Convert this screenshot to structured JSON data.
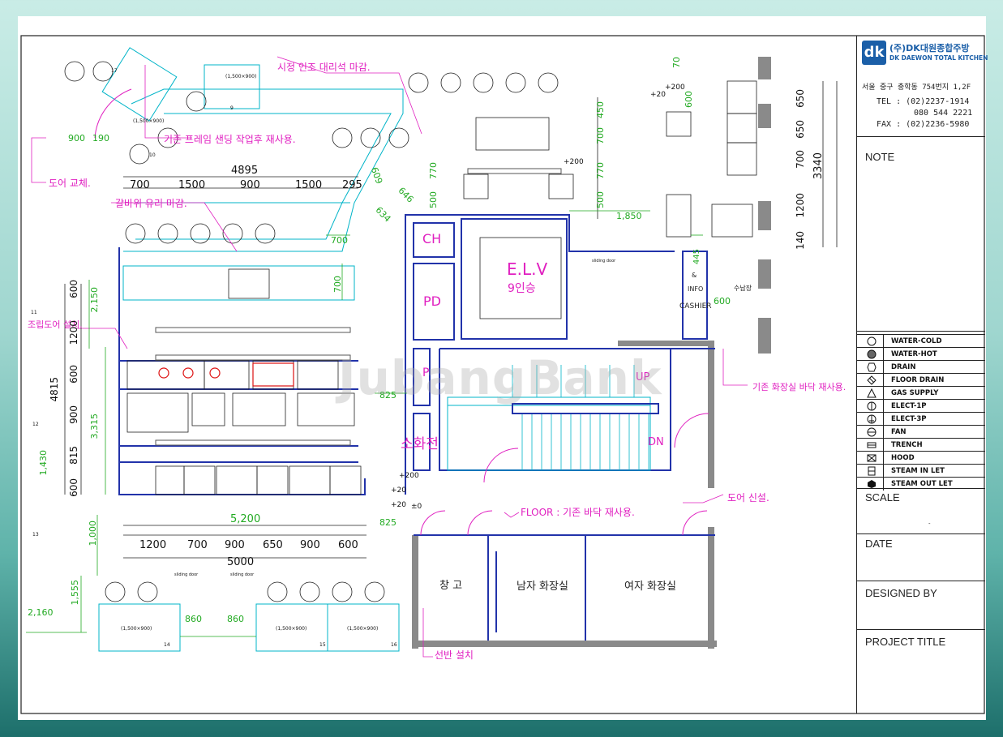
{
  "title_block": {
    "company_ko": "(주)DK대원종합주방",
    "company_en": "DK DAEWON TOTAL KITCHEN",
    "logo_text": "dk",
    "address": "서울 중구 충학동 754번지 1,2F",
    "tel": "TEL : (02)2237-1914",
    "tel2": "080 544 2221",
    "fax": "FAX : (02)2236-5980",
    "note_label": "NOTE",
    "scale_label": "SCALE",
    "scale_value": "-",
    "date_label": "DATE",
    "designed_label": "DESIGNED BY",
    "project_label": "PROJECT TITLE"
  },
  "legend": [
    {
      "icon": "circle-icon",
      "label": "WATER-COLD"
    },
    {
      "icon": "hatched-circle-icon",
      "label": "WATER-HOT"
    },
    {
      "icon": "drain-icon",
      "label": "DRAIN"
    },
    {
      "icon": "floor-drain-icon",
      "label": "FLOOR DRAIN"
    },
    {
      "icon": "triangle-icon",
      "label": "GAS SUPPLY"
    },
    {
      "icon": "elect-1p-icon",
      "label": "ELECT-1P"
    },
    {
      "icon": "elect-3p-icon",
      "label": "ELECT-3P"
    },
    {
      "icon": "fan-icon",
      "label": "FAN"
    },
    {
      "icon": "trench-icon",
      "label": "TRENCH"
    },
    {
      "icon": "hood-icon",
      "label": "HOOD"
    },
    {
      "icon": "steam-in-icon",
      "label": "STEAM IN LET"
    },
    {
      "icon": "steam-out-icon",
      "label": "STEAM OUT LET"
    }
  ],
  "annotations": {
    "marble": "시정 인조 대리석 마감.",
    "frame": "기존 프레임 샌딩 작업후 재사용.",
    "door_replace": "도어 교체.",
    "glass": "갈바위 유리 마감.",
    "storage_door": "조립도어 설치.",
    "floor": "FLOOR : 기존 바닥 재사용.",
    "new_door": "도어 신설.",
    "existing_floor": "기존 화장실 바닥 재사용.",
    "shelf": "선반 설치",
    "watermark": "JubangBank"
  },
  "rooms": {
    "ch": "CH",
    "pd": "PD",
    "p": "P",
    "hydrant": "소화전",
    "elevator": "E.L.V",
    "elevator_cap": "9인승",
    "info": "&",
    "info2": "INFO",
    "cashier": "CASHIER",
    "storage": "창 고",
    "men": "남자 화장실",
    "women": "여자 화장실",
    "up": "UP",
    "dn": "DN",
    "sink": "수납장"
  },
  "dims": {
    "d4895": "4895",
    "top_row": [
      "700",
      "1500",
      "900",
      "1500",
      "295"
    ],
    "d5200": "5,200",
    "d5000": "5000",
    "bot_row": [
      "1200",
      "700",
      "900",
      "650",
      "900",
      "600"
    ],
    "d4815": "4815",
    "left_col": [
      "600",
      "1200",
      "600",
      "900",
      "815",
      "600"
    ],
    "d2150": "2,150",
    "d3315": "3,315",
    "d1430": "1,430",
    "d1000": "1,000",
    "d1555": "1,555",
    "d2160": "2,160",
    "d860a": "860",
    "d860b": "860",
    "d900": "900",
    "d190": "190",
    "d700a": "700",
    "d700b": "700",
    "d825a": "825",
    "d825b": "825",
    "d1850": "1,850",
    "d3340": "3340",
    "right_col": [
      "650",
      "650",
      "700",
      "1200",
      "140"
    ],
    "mid_col": [
      "450",
      "700",
      "770",
      "500"
    ],
    "d770": "770",
    "d500": "500",
    "d445": "445",
    "d600": "600",
    "d600b": "600",
    "d70": "70",
    "d646": "646",
    "d634": "634",
    "d609": "609",
    "lv20a": "+20",
    "lv20b": "+20",
    "lv200a": "+200",
    "lv200b": "+200",
    "lv200c": "+200",
    "lv0": "±0",
    "lv20c": "+20"
  },
  "tables": [
    {
      "size": "(1,500×900)",
      "no": "9"
    },
    {
      "size": "(1,500×900)",
      "no": "10"
    },
    {
      "size": "(1,500×900)",
      "no": "14"
    },
    {
      "size": "(1,500×900)",
      "no": "15"
    },
    {
      "size": "(1,500×900)",
      "no": "16"
    }
  ],
  "table_nums_left": [
    "11",
    "12",
    "13"
  ],
  "table_17": "17",
  "sliding_door": "sliding door"
}
